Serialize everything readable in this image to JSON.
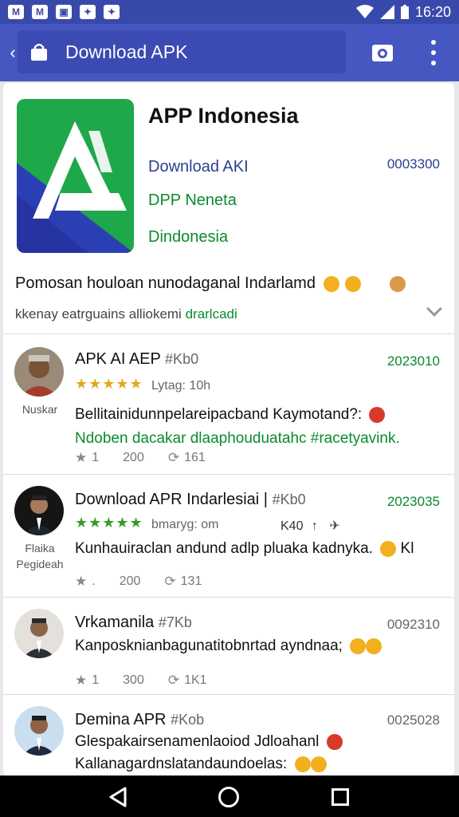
{
  "status_bar": {
    "time": "16:20",
    "icons": [
      "gmail-icon",
      "gmail-icon",
      "image-icon",
      "notification-icon",
      "notification-icon"
    ]
  },
  "app_bar": {
    "back_icon": "chevron-left-icon",
    "title": "Download APK",
    "actions": [
      "camera-icon",
      "more-vert-icon"
    ]
  },
  "app_card": {
    "name": "APP Indonesia",
    "line1": "Download AKI",
    "line1_value": "0003300",
    "line2": "DPP Neneta",
    "line3": "Dindonesia",
    "description": "Pomosan houloan nunodaganal Indarlamd",
    "subdescription": "kkenay eatrguains alliokemi",
    "subdescription_highlight": "drarlcadi"
  },
  "comments": [
    {
      "name": "APK AI AEP",
      "tag": "#Kb0",
      "date": "2023010",
      "avatar_label": "Nuskar",
      "stars": "★★★★★",
      "meta": "Lytag: 10h",
      "text": "Bellitainidunnpelareipacband Kaymotand?:",
      "text2": "Ndoben dacakar dlaaphouduatahc #racetyavink.",
      "likes": "1",
      "replies": "200",
      "shares": "161"
    },
    {
      "name": "Download APR  Indarlesiai |",
      "tag": "#Kb0",
      "date": "2023035",
      "avatar_label": "Flaika Pegideah",
      "stars": "★★★★★",
      "meta": "bmaryg: om",
      "extra": "K40",
      "text": "Kunhauiraclan andund adlp pluaka kadnyka.",
      "text_suffix": "Kl",
      "likes": ".",
      "replies": "200",
      "shares": "131"
    },
    {
      "name": "Vrkamanila",
      "tag": "#7Kb",
      "date": "0092310",
      "text": "Kanposknianbagunatitobnrtad ayndnaa;",
      "likes": "1",
      "replies": "300",
      "shares": "1K1"
    },
    {
      "name": "Demina APR",
      "tag": "#Kob",
      "date": "0025028",
      "text": "Glespakairsenamenlaoiod Jdloahanl",
      "text2": "Kallanagardnslatandaundoelas:"
    }
  ],
  "nav_bar": [
    "back-triangle-icon",
    "home-circle-icon",
    "recents-square-icon"
  ]
}
